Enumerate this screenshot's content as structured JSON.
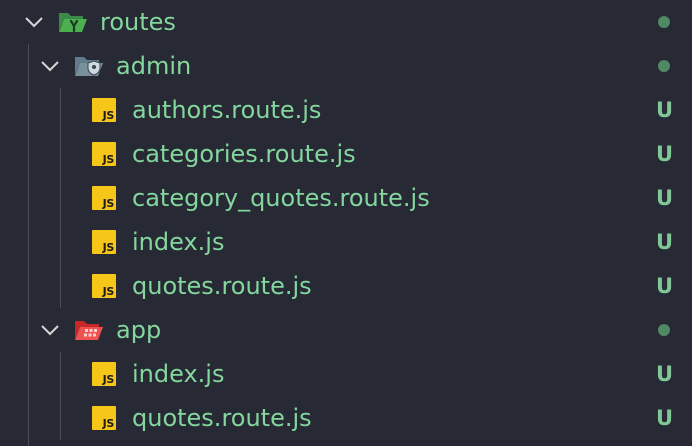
{
  "explorer": {
    "root_folder": {
      "name": "routes",
      "icon": "folder-routes-open-icon",
      "status_indicator": "dot"
    },
    "admin_folder": {
      "name": "admin",
      "icon": "folder-admin-open-icon",
      "status_indicator": "dot",
      "files": [
        {
          "name": "authors.route.js",
          "status": "U"
        },
        {
          "name": "categories.route.js",
          "status": "U"
        },
        {
          "name": "category_quotes.route.js",
          "status": "U"
        },
        {
          "name": "index.js",
          "status": "U"
        },
        {
          "name": "quotes.route.js",
          "status": "U"
        }
      ]
    },
    "app_folder": {
      "name": "app",
      "icon": "folder-app-open-icon",
      "status_indicator": "dot",
      "files": [
        {
          "name": "index.js",
          "status": "U"
        },
        {
          "name": "quotes.route.js",
          "status": "U"
        }
      ]
    },
    "js_badge": "JS"
  },
  "colors": {
    "background": "#272935",
    "untracked_text": "#83d69c",
    "status_text": "#7fc896",
    "dot": "#4f8a64",
    "js_badge": "#f5c518",
    "routes_folder": "#4aa35a",
    "admin_folder": "#78909c",
    "app_folder": "#e5534b"
  }
}
